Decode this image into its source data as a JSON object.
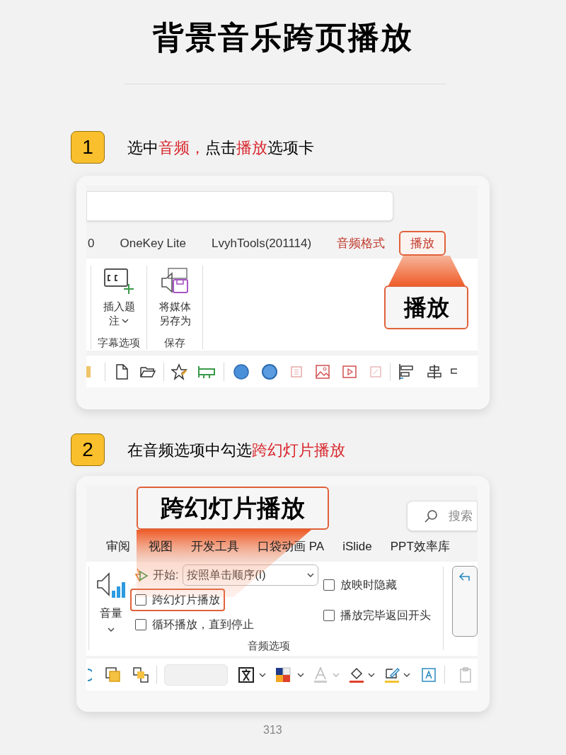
{
  "title": "背景音乐跨页播放",
  "steps": [
    {
      "number": "1",
      "instruction": "选中**音频，**点击**播放**选项卡",
      "screenshot": {
        "kind": "ribbon_tab",
        "tabs": [
          {
            "label": "0",
            "selected": false,
            "contextual": false
          },
          {
            "label": "OneKey Lite",
            "selected": false,
            "contextual": false
          },
          {
            "label": "LvyhTools(201114)",
            "selected": false,
            "contextual": false
          },
          {
            "label": "音频格式",
            "selected": false,
            "contextual": true
          },
          {
            "label": "播放",
            "selected": true,
            "contextual": true
          }
        ],
        "groups": [
          {
            "label": "字幕选项",
            "button": {
              "lines": [
                "插入题",
                "注"
              ],
              "dropdown": true
            }
          },
          {
            "label": "保存",
            "button": {
              "lines": [
                "将媒体",
                "另存为"
              ],
              "dropdown": false
            }
          }
        ],
        "callout": "播放"
      }
    },
    {
      "number": "2",
      "instruction": "在音频选项中勾选**跨幻灯片播放**",
      "screenshot": {
        "kind": "audio_options",
        "search": {
          "placeholder": "搜索"
        },
        "tabs": [
          {
            "label": "审阅"
          },
          {
            "label": "视图"
          },
          {
            "label": "开发工具"
          },
          {
            "label": "口袋动画 PA"
          },
          {
            "label": "iSlide"
          },
          {
            "label": "PPT效率库"
          }
        ],
        "volume": {
          "label": "音量"
        },
        "start": {
          "label": "开始:",
          "value": "按照单击顺序(I)"
        },
        "options": [
          {
            "label": "跨幻灯片播放",
            "checked": false,
            "highlighted": true
          },
          {
            "label": "循环播放，直到停止",
            "checked": false,
            "highlighted": false
          },
          {
            "label": "放映时隐藏",
            "checked": false,
            "highlighted": false
          },
          {
            "label": "播放完毕返回开头",
            "checked": false,
            "highlighted": false
          }
        ],
        "group_label": "音频选项",
        "callout": "跨幻灯片播放"
      }
    }
  ],
  "page_number": "313"
}
